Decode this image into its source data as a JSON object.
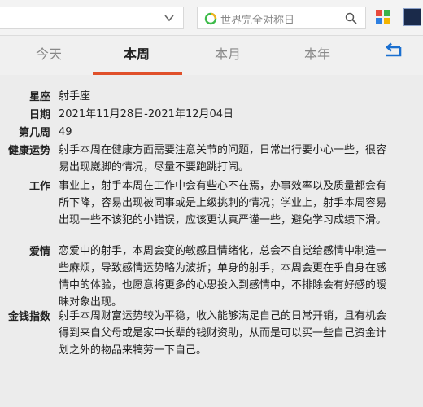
{
  "toolbar": {
    "search_placeholder": "世界完全对称日"
  },
  "tabs": [
    {
      "label": "今天"
    },
    {
      "label": "本周"
    },
    {
      "label": "本月"
    },
    {
      "label": "本年"
    }
  ],
  "active_tab": "本周",
  "accent_color": "#e0502a",
  "details": {
    "constellation": {
      "label": "星座",
      "value": "射手座"
    },
    "date": {
      "label": "日期",
      "value": "2021年11月28日-2021年12月04日"
    },
    "week": {
      "label": "第几周",
      "value": "49"
    },
    "health": {
      "label": "健康运势",
      "value": "射手本周在健康方面需要注意关节的问题，日常出行要小心一些，很容易出现崴脚的情况，尽量不要跑跳打闹。"
    },
    "work": {
      "label": "工作",
      "value": "事业上，射手本周在工作中会有些心不在焉，办事效率以及质量都会有所下降，容易出现被同事或是上级挑刺的情况；学业上，射手本周容易出现一些不该犯的小错误，应该更认真严谨一些，避免学习成绩下滑。"
    },
    "love": {
      "label": "爱情",
      "value": "恋爱中的射手，本周会变的敏感且情绪化，总会不自觉给感情中制造一些麻烦，导致感情运势略为波折；单身的射手，本周会更在乎自身在感情中的体验，也愿意将更多的心思投入到感情中，不排除会有好感的暧昧对象出现。"
    },
    "money": {
      "label": "金钱指数",
      "value": "射手本周财富运势较为平稳，收入能够满足自己的日常开销，且有机会得到来自父母或是家中长辈的钱财资助，从而是可以买一些自己资金计划之外的物品来犒劳一下自己。"
    }
  }
}
